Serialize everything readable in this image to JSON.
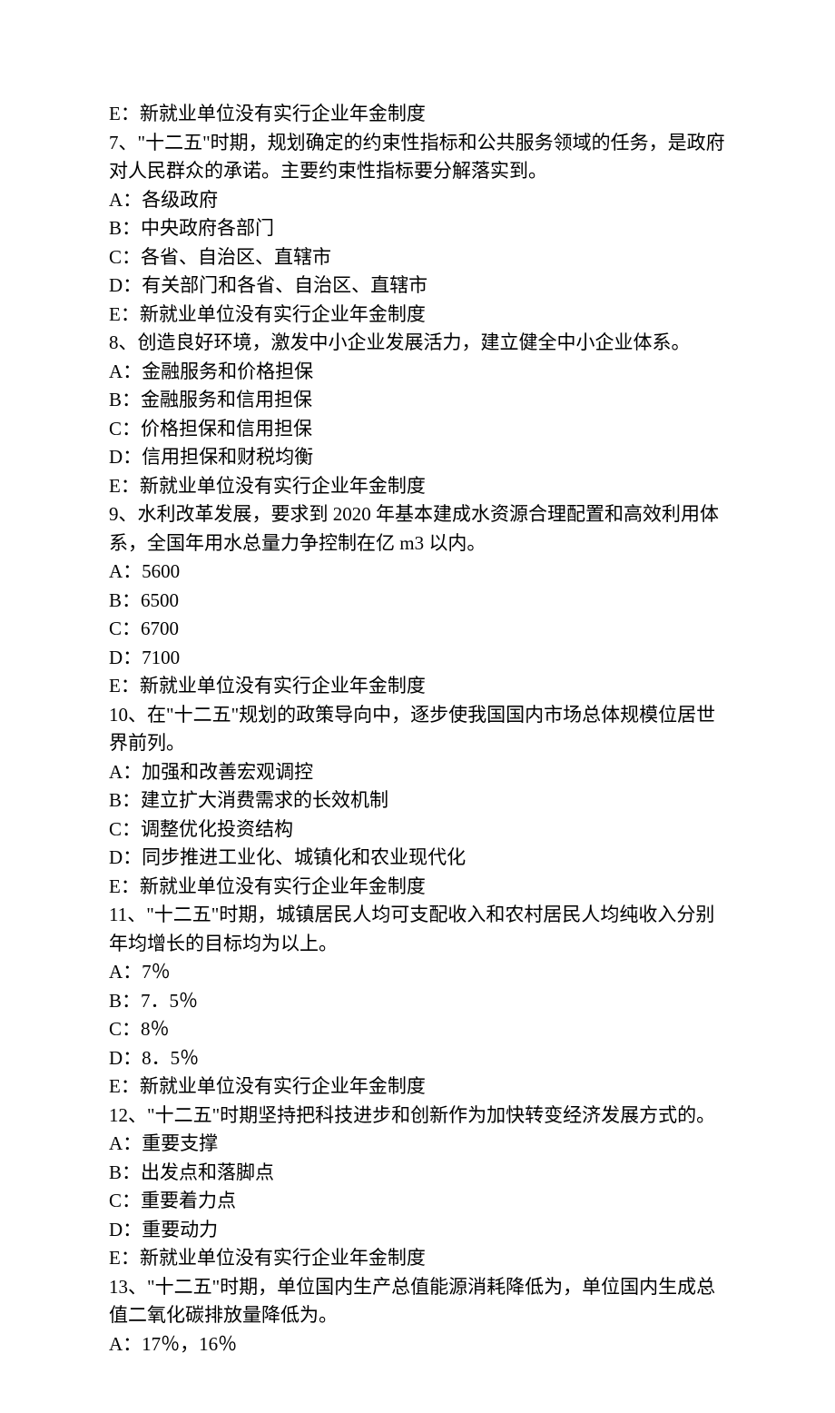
{
  "lines": [
    "E：新就业单位没有实行企业年金制度",
    "7、\"十二五\"时期，规划确定的约束性指标和公共服务领域的任务，是政府对人民群众的承诺。主要约束性指标要分解落实到。",
    "A：各级政府",
    "B：中央政府各部门",
    "C：各省、自治区、直辖市",
    "D：有关部门和各省、自治区、直辖市",
    "E：新就业单位没有实行企业年金制度",
    "8、创造良好环境，激发中小企业发展活力，建立健全中小企业体系。",
    "A：金融服务和价格担保",
    "B：金融服务和信用担保",
    "C：价格担保和信用担保",
    "D：信用担保和财税均衡",
    "E：新就业单位没有实行企业年金制度",
    "9、水利改革发展，要求到 2020 年基本建成水资源合理配置和高效利用体系，全国年用水总量力争控制在亿 m3 以内。",
    "A：5600",
    "B：6500",
    "C：6700",
    "D：7100",
    "E：新就业单位没有实行企业年金制度",
    "10、在\"十二五\"规划的政策导向中，逐步使我国国内市场总体规模位居世界前列。",
    "A：加强和改善宏观调控",
    "B：建立扩大消费需求的长效机制",
    "C：调整优化投资结构",
    "D：同步推进工业化、城镇化和农业现代化",
    "E：新就业单位没有实行企业年金制度",
    "11、\"十二五\"时期，城镇居民人均可支配收入和农村居民人均纯收入分别年均增长的目标均为以上。",
    "A：7％",
    "B：7．5％",
    "C：8％",
    "D：8．5％",
    "E：新就业单位没有实行企业年金制度",
    "12、\"十二五\"时期坚持把科技进步和创新作为加快转变经济发展方式的。",
    "A：重要支撑",
    "B：出发点和落脚点",
    "C：重要着力点",
    "D：重要动力",
    "E：新就业单位没有实行企业年金制度",
    "13、\"十二五\"时期，单位国内生产总值能源消耗降低为，单位国内生成总值二氧化碳排放量降低为。",
    "A：17％，16％"
  ]
}
